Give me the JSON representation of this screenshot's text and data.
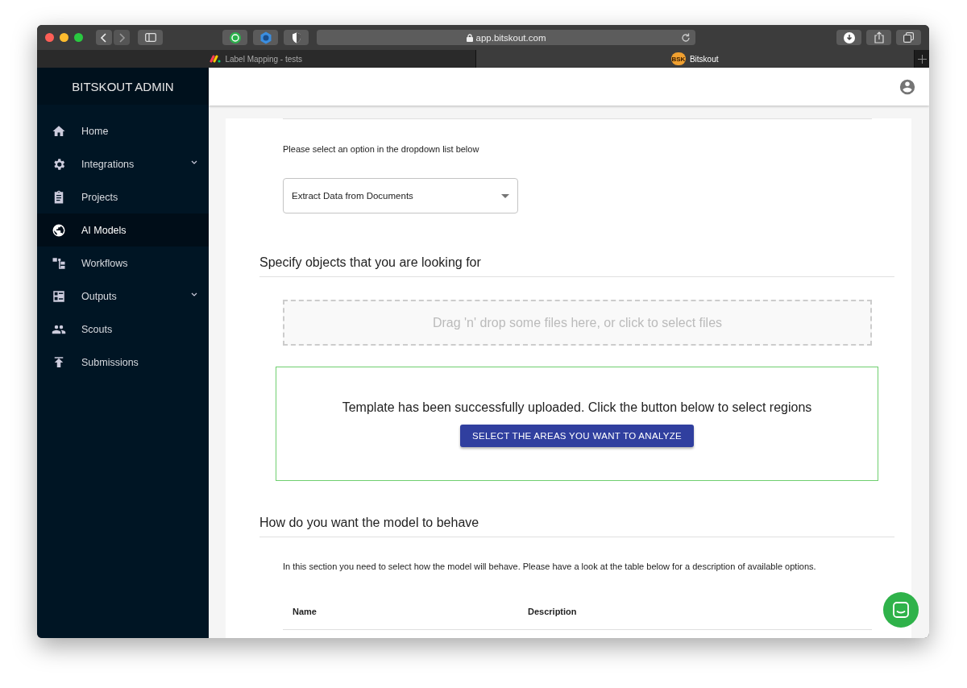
{
  "browser": {
    "url": "app.bitskout.com",
    "tabs": [
      {
        "title": "Label Mapping - tests",
        "selected": false
      },
      {
        "title": "Bitskout",
        "selected": true,
        "badge": "BSK"
      }
    ]
  },
  "sidebar": {
    "title": "BITSKOUT ADMIN",
    "items": [
      {
        "label": "Home",
        "selected": false,
        "has_submenu": false
      },
      {
        "label": "Integrations",
        "selected": false,
        "has_submenu": true
      },
      {
        "label": "Projects",
        "selected": false,
        "has_submenu": false
      },
      {
        "label": "AI Models",
        "selected": true,
        "has_submenu": false
      },
      {
        "label": "Workflows",
        "selected": false,
        "has_submenu": false
      },
      {
        "label": "Outputs",
        "selected": false,
        "has_submenu": true
      },
      {
        "label": "Scouts",
        "selected": false,
        "has_submenu": false
      },
      {
        "label": "Submissions",
        "selected": false,
        "has_submenu": false
      }
    ]
  },
  "main": {
    "dropdown_prompt": "Please select an option in the dropdown list below",
    "dropdown": {
      "value": "Extract Data from Documents"
    },
    "objects_section": {
      "heading": "Specify objects that you are looking for",
      "dropzone": {
        "text": "Drag 'n' drop some files here, or click to select files"
      },
      "upload_notice": {
        "text": "Template has been successfully uploaded. Click the button below to select regions",
        "button": "SELECT THE AREAS YOU WANT TO ANALYZE"
      }
    },
    "behaviour_section": {
      "heading": "How do you want the model to behave",
      "description": "In this section you need to select how the model will behave. Please have a look at the table below for a description of available options.",
      "table": {
        "columns": [
          "Name",
          "Description"
        ]
      }
    }
  }
}
